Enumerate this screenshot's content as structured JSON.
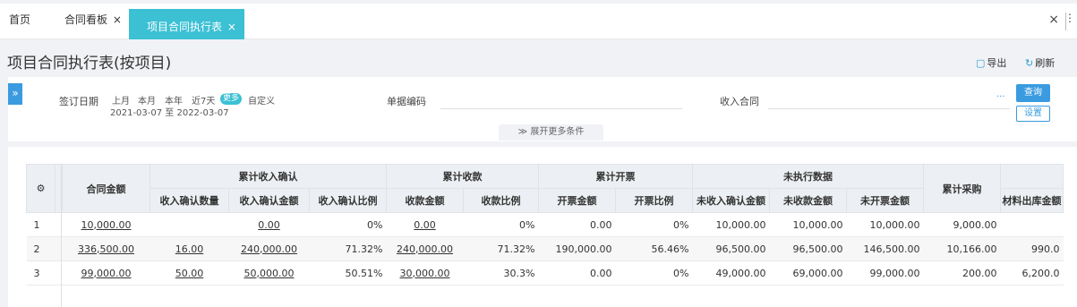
{
  "tabs": {
    "home": "首页",
    "board": "合同看板",
    "active": "项目合同执行表",
    "close_glyph": "×",
    "window_close": "×"
  },
  "page": {
    "title": "项目合同执行表(按项目)",
    "export_label": "导出",
    "refresh_label": "刷新"
  },
  "filter": {
    "toggle_glyph": "»",
    "sign_date_label": "签订日期",
    "quick": [
      "上月",
      "本月",
      "本年",
      "近7天"
    ],
    "more": "更多",
    "custom": "自定义",
    "date_range": "2021-03-07 至 2022-03-07",
    "doc_no_label": "单据编码",
    "income_contract_label": "收入合同",
    "income_dots": "···",
    "query_button": "查询",
    "settings_button": "设置",
    "expand_more": "≫ 展开更多条件"
  },
  "table": {
    "settings_icon": "⚙",
    "headers": {
      "contract_amount": "合同金额",
      "cum_income_confirm": "累计收入确认",
      "cum_collection": "累计收款",
      "cum_invoice": "累计开票",
      "unexecuted": "未执行数据",
      "cum_purchase": "累计采购",
      "material_group_partial": "",
      "income_qty": "收入确认数量",
      "income_amt": "收入确认金额",
      "income_ratio": "收入确认比例",
      "collect_amt": "收款金额",
      "collect_ratio": "收款比例",
      "invoice_amt": "开票金额",
      "invoice_ratio": "开票比例",
      "un_income": "未收入确认金额",
      "un_collect": "未收款金额",
      "un_invoice": "未开票金额",
      "material_out": "材料出库金额"
    },
    "rows": [
      {
        "idx": "1",
        "contract_amount": "10,000.00",
        "income_qty": "",
        "income_amt": "0.00",
        "income_ratio": "0%",
        "collect_amt": "0.00",
        "collect_ratio": "0%",
        "invoice_amt": "0.00",
        "invoice_ratio": "0%",
        "un_income": "10,000.00",
        "un_collect": "10,000.00",
        "un_invoice": "10,000.00",
        "cum_purchase": "9,000.00",
        "material_out": ""
      },
      {
        "idx": "2",
        "contract_amount": "336,500.00",
        "income_qty": "16.00",
        "income_amt": "240,000.00",
        "income_ratio": "71.32%",
        "collect_amt": "240,000.00",
        "collect_ratio": "71.32%",
        "invoice_amt": "190,000.00",
        "invoice_ratio": "56.46%",
        "un_income": "96,500.00",
        "un_collect": "96,500.00",
        "un_invoice": "146,500.00",
        "cum_purchase": "10,166.00",
        "material_out": "990.0"
      },
      {
        "idx": "3",
        "contract_amount": "99,000.00",
        "income_qty": "50.00",
        "income_amt": "50,000.00",
        "income_ratio": "50.51%",
        "collect_amt": "30,000.00",
        "collect_ratio": "30.3%",
        "invoice_amt": "0.00",
        "invoice_ratio": "0%",
        "un_income": "49,000.00",
        "un_collect": "69,000.00",
        "un_invoice": "99,000.00",
        "cum_purchase": "200.00",
        "material_out": "6,200.0"
      }
    ]
  }
}
